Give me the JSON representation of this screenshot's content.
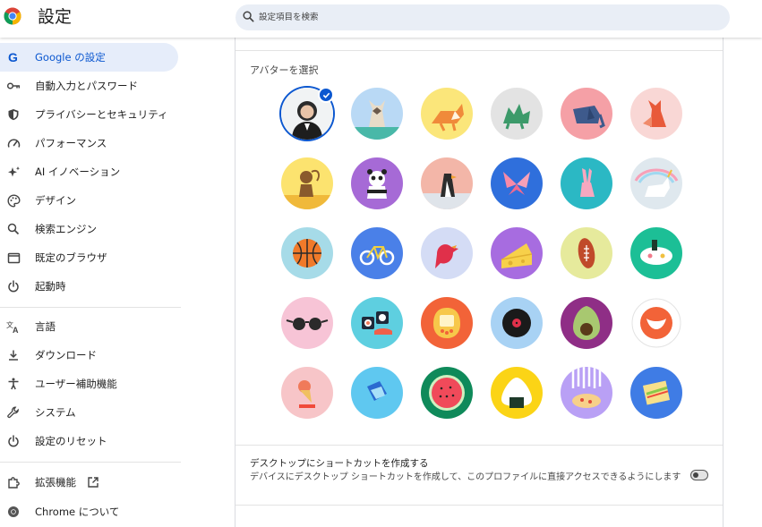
{
  "header": {
    "title": "設定",
    "search_placeholder": "設定項目を検索"
  },
  "sidebar": {
    "items": [
      {
        "label": "Google の設定",
        "icon": "google-icon",
        "active": true
      },
      {
        "label": "自動入力とパスワード",
        "icon": "key-icon"
      },
      {
        "label": "プライバシーとセキュリティ",
        "icon": "shield-icon"
      },
      {
        "label": "パフォーマンス",
        "icon": "speedometer-icon"
      },
      {
        "label": "AI イノベーション",
        "icon": "sparkle-icon"
      },
      {
        "label": "デザイン",
        "icon": "palette-icon"
      },
      {
        "label": "検索エンジン",
        "icon": "search-icon"
      },
      {
        "label": "既定のブラウザ",
        "icon": "browser-window-icon"
      },
      {
        "label": "起動時",
        "icon": "power-icon"
      },
      {
        "label": "言語",
        "icon": "translate-icon"
      },
      {
        "label": "ダウンロード",
        "icon": "download-icon"
      },
      {
        "label": "ユーザー補助機能",
        "icon": "accessibility-icon"
      },
      {
        "label": "システム",
        "icon": "wrench-icon"
      },
      {
        "label": "設定のリセット",
        "icon": "reset-icon"
      },
      {
        "label": "拡張機能",
        "icon": "puzzle-icon"
      },
      {
        "label": "Chrome について",
        "icon": "chrome-icon"
      }
    ]
  },
  "avatar_section": {
    "title": "アバターを選択",
    "avatars": [
      {
        "name": "photo",
        "bg": "#f1f3f4"
      },
      {
        "name": "cat",
        "bg": "#b9d9f5"
      },
      {
        "name": "fox",
        "bg": "#fbe67a"
      },
      {
        "name": "dragon",
        "bg": "#e3e3e3"
      },
      {
        "name": "elephant",
        "bg": "#f5a0a6"
      },
      {
        "name": "fox-red",
        "bg": "#f9d7d5"
      },
      {
        "name": "monkey",
        "bg": "#fce36f"
      },
      {
        "name": "panda",
        "bg": "#a66ad6"
      },
      {
        "name": "penguin",
        "bg": "#f3b6a8"
      },
      {
        "name": "butterfly",
        "bg": "#2f6fdc"
      },
      {
        "name": "rabbit",
        "bg": "#2bb8c4"
      },
      {
        "name": "unicorn",
        "bg": "#dfe8ee"
      },
      {
        "name": "basketball",
        "bg": "#a6dbe8"
      },
      {
        "name": "bicycle",
        "bg": "#4a80e8"
      },
      {
        "name": "bird",
        "bg": "#d4dcf5"
      },
      {
        "name": "cheese",
        "bg": "#a76ce0"
      },
      {
        "name": "football",
        "bg": "#e6ea9c"
      },
      {
        "name": "sushi-plate",
        "bg": "#1cbf96"
      },
      {
        "name": "sunglasses",
        "bg": "#f7c4d6"
      },
      {
        "name": "sushi",
        "bg": "#5ecfe0"
      },
      {
        "name": "tamagotchi",
        "bg": "#f26338"
      },
      {
        "name": "vinyl",
        "bg": "#a8d2f4"
      },
      {
        "name": "avocado",
        "bg": "#8f2e86"
      },
      {
        "name": "smiley",
        "bg": "#ffffff"
      },
      {
        "name": "ice-cream",
        "bg": "#f7c5c8"
      },
      {
        "name": "rice-note",
        "bg": "#5fc8f0"
      },
      {
        "name": "watermelon",
        "bg": "#0f8a5a"
      },
      {
        "name": "onigiri",
        "bg": "#fbd416"
      },
      {
        "name": "pizza",
        "bg": "#b9a0f5"
      },
      {
        "name": "sandwich",
        "bg": "#3f7ce5"
      }
    ],
    "selected_index": 0
  },
  "shortcut": {
    "title": "デスクトップにショートカットを作成する",
    "description": "デバイスにデスクトップ ショートカットを作成して、このプロファイルに直接アクセスできるようにします",
    "enabled": false
  },
  "colors": {
    "accent": "#0b57d0",
    "active_bg": "#e6edfa",
    "search_bg": "#e9eef6"
  }
}
